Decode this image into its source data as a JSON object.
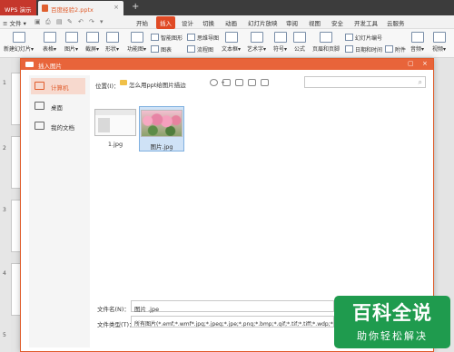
{
  "titlebar": {
    "app_tab": "WPS 演示",
    "doc_tab": "百度经验2.pptx",
    "close_glyph": "×",
    "new_tab_glyph": "+"
  },
  "menubar": {
    "file_button": "≡ 文件 ▾",
    "items": [
      "开始",
      "插入",
      "设计",
      "切换",
      "动画",
      "幻灯片放映",
      "审阅",
      "视图",
      "安全",
      "开发工具",
      "云服务"
    ],
    "active_item": "插入",
    "active_color": "#e04a25"
  },
  "ribbon": {
    "items": [
      "新建幻灯片▾",
      "表格▾",
      "图片▾",
      "截屏▾",
      "形状▾",
      "功能图▾",
      "图表"
    ],
    "small_items": [
      "智能图形",
      "思维导图",
      "流程图"
    ],
    "items2": [
      "文本框▾",
      "艺术字▾",
      "符号▾",
      "公式"
    ],
    "small_items2": [
      "页眉和页脚",
      "幻灯片编号",
      "日期和时间",
      "附件"
    ],
    "items3": [
      "音频▾",
      "视频▾"
    ]
  },
  "slides": {
    "numbers": [
      "1",
      "2",
      "3",
      "4",
      "5"
    ]
  },
  "dialog": {
    "title": "插入图片",
    "minimize": "▢",
    "close": "×",
    "accent_color": "#e8643a",
    "sidebar": [
      {
        "label": "计算机",
        "active": true,
        "icon": "computer-icon"
      },
      {
        "label": "桌面",
        "active": false,
        "icon": "desktop-icon"
      },
      {
        "label": "我的文档",
        "active": false,
        "icon": "documents-icon"
      }
    ],
    "location_label": "位置(I)：",
    "location_value": "怎么用ppt给图片描边",
    "files": [
      {
        "name": "1.jpg",
        "selected": false
      },
      {
        "name": "图片.jpg",
        "selected": true
      }
    ],
    "filename_label": "文件名(N)：",
    "filename_value": "图片 .jpe",
    "filetype_label": "文件类型(T)：",
    "filetype_value": "所有图片(*.emf;*.wmf*.jpg;*.jpeg;*.jpe;*.png;*.bmp;*.gif;*.tif;*.tiff;*.wdp;*.svg)"
  },
  "watermark": {
    "line1": "百科全说",
    "line2": "助你轻松解决",
    "color": "#1f9b4e"
  }
}
